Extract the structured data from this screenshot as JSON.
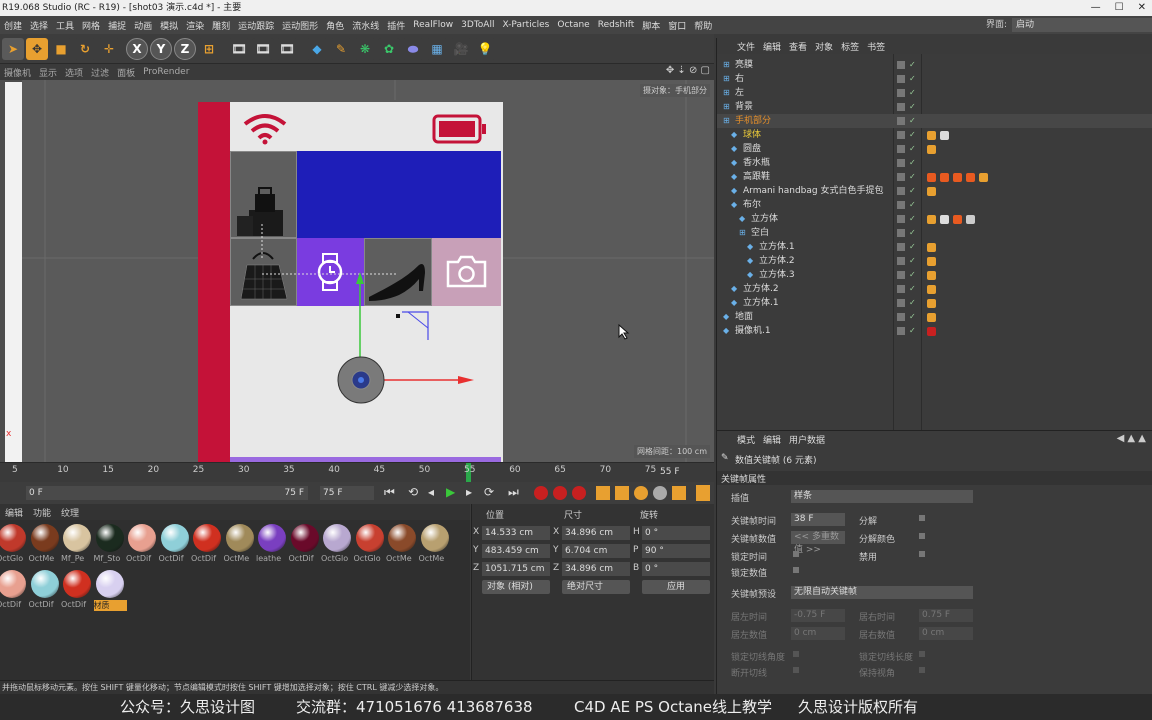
{
  "window": {
    "title": "R19.068 Studio (RC - R19) - [shot03 演示.c4d *] - 主要"
  },
  "menubar": {
    "items": [
      "创建",
      "选择",
      "工具",
      "网格",
      "捕捉",
      "动画",
      "模拟",
      "渲染",
      "雕刻",
      "运动跟踪",
      "运动图形",
      "角色",
      "流水线",
      "插件",
      "RealFlow",
      "3DToAll",
      "X-Particles",
      "Octane",
      "Redshift",
      "脚本",
      "窗口",
      "帮助"
    ],
    "layout_label": "界面:",
    "layout_value": "启动"
  },
  "viewport": {
    "menu": [
      "摄像机",
      "显示",
      "选项",
      "过滤",
      "面板",
      "ProRender"
    ],
    "camera_label": "摄对象：手机部分",
    "grid_label": "网格间距：100 cm"
  },
  "timeline": {
    "ticks": [
      "5",
      "10",
      "15",
      "20",
      "25",
      "30",
      "35",
      "40",
      "45",
      "50",
      "55",
      "60",
      "65",
      "70",
      "75"
    ],
    "current_frame": "55 F"
  },
  "playbar": {
    "start": "0 F",
    "range_end": "75 F",
    "end": "75 F"
  },
  "materials": {
    "menu": [
      "编辑",
      "功能",
      "纹理"
    ],
    "items": [
      {
        "label": "OctGlo",
        "color": "#c0392b"
      },
      {
        "label": "OctMe",
        "color": "#7a3b1e"
      },
      {
        "label": "Mf_Pe",
        "color": "#d8c4a0"
      },
      {
        "label": "Mf_Sto",
        "color": "#1b2b1f"
      },
      {
        "label": "OctDif",
        "color": "#e8a090"
      },
      {
        "label": "OctDif",
        "color": "#8fcfd8"
      },
      {
        "label": "OctDif",
        "color": "#d03020"
      },
      {
        "label": "OctMe",
        "color": "#a08a5a"
      },
      {
        "label": "leathe",
        "color": "#7a3fc0"
      },
      {
        "label": "OctDif",
        "color": "#6a0a2a"
      },
      {
        "label": "OctGlo",
        "color": "#b8a8d0"
      },
      {
        "label": "OctGlo",
        "color": "#c84030"
      },
      {
        "label": "OctMe",
        "color": "#8a4a2a"
      },
      {
        "label": "OctMe",
        "color": "#b8a070"
      },
      {
        "label": "OctDif",
        "color": "#e8a090"
      },
      {
        "label": "OctDif",
        "color": "#8fcfd8"
      },
      {
        "label": "OctDif",
        "color": "#d03020"
      },
      {
        "label": "材质",
        "color": "#d8d0f0"
      }
    ]
  },
  "coords": {
    "headers": {
      "position": "位置",
      "size": "尺寸",
      "rotation": "旋转"
    },
    "rows": [
      {
        "axis": "X",
        "pos": "14.533 cm",
        "size_axis": "X",
        "size": "34.896 cm",
        "rot_axis": "H",
        "rot": "0 °"
      },
      {
        "axis": "Y",
        "pos": "483.459 cm",
        "size_axis": "Y",
        "size": "6.704 cm",
        "rot_axis": "P",
        "rot": "90 °"
      },
      {
        "axis": "Z",
        "pos": "1051.715 cm",
        "size_axis": "Z",
        "size": "34.896 cm",
        "rot_axis": "B",
        "rot": "0 °"
      }
    ],
    "mode": "对象 (相对)",
    "size_mode": "绝对尺寸",
    "apply": "应用"
  },
  "status": "并拖动鼠标移动元素。按住 SHIFT 键量化移动；节点编辑模式时按住 SHIFT 键增加选择对象；按住 CTRL 键减少选择对象。",
  "footer": {
    "a": "公众号：久思设计图",
    "b": "交流群：471051676  413687638",
    "c": "C4D AE PS Octane线上教学",
    "d": "久思设计版权所有"
  },
  "objects": {
    "menu": [
      "文件",
      "编辑",
      "查看",
      "对象",
      "标签",
      "书签"
    ],
    "rows": [
      {
        "name": "亮膜",
        "indent": 0,
        "color": "#ddd"
      },
      {
        "name": "右",
        "indent": 0,
        "color": "#ddd"
      },
      {
        "name": "左",
        "indent": 0,
        "color": "#ddd"
      },
      {
        "name": "背景",
        "indent": 0,
        "color": "#ddd"
      },
      {
        "name": "手机部分",
        "indent": 0,
        "color": "#e8902a"
      },
      {
        "name": "球体",
        "indent": 1,
        "color": "#e8c83a"
      },
      {
        "name": "圆盘",
        "indent": 1,
        "color": "#ddd"
      },
      {
        "name": "香水瓶",
        "indent": 1,
        "color": "#ddd"
      },
      {
        "name": "高跟鞋",
        "indent": 1,
        "color": "#ddd"
      },
      {
        "name": "Armani handbag 女式白色手提包",
        "indent": 1,
        "color": "#ddd"
      },
      {
        "name": "布尔",
        "indent": 1,
        "color": "#ddd"
      },
      {
        "name": "立方体",
        "indent": 2,
        "color": "#ddd"
      },
      {
        "name": "空白",
        "indent": 2,
        "color": "#ddd"
      },
      {
        "name": "立方体.1",
        "indent": 3,
        "color": "#ddd"
      },
      {
        "name": "立方体.2",
        "indent": 3,
        "color": "#ddd"
      },
      {
        "name": "立方体.3",
        "indent": 3,
        "color": "#ddd"
      },
      {
        "name": "立方体.2",
        "indent": 1,
        "color": "#ddd"
      },
      {
        "name": "立方体.1",
        "indent": 1,
        "color": "#ddd"
      },
      {
        "name": "地面",
        "indent": 0,
        "color": "#ddd"
      },
      {
        "name": "摄像机.1",
        "indent": 0,
        "color": "#ddd"
      }
    ]
  },
  "attributes": {
    "menu": [
      "模式",
      "编辑",
      "用户数据"
    ],
    "header": "数值关键帧 (6 元素)",
    "section1": "关键帧属性",
    "interp_label": "插值",
    "interp_value": "样条",
    "key_time_label": "关键帧时间",
    "key_time_value": "38 F",
    "key_value_label": "关键帧数值",
    "key_value_value": "<< 多重数值 >>",
    "lock_time": "锁定时间",
    "lock_value": "锁定数值",
    "break_label": "分解",
    "break_color": "分解颜色",
    "mute": "禁用",
    "preset_label": "关键帧预设",
    "preset_value": "无限自动关键帧",
    "left_time": "居左时间",
    "left_time_val": "-0.75 F",
    "right_time": "居右时间",
    "right_time_val": "0.75 F",
    "left_value": "居左数值",
    "left_value_val": "0 cm",
    "right_value": "居右数值",
    "right_value_val": "0 cm",
    "lock_tangent_angle": "锁定切线角度",
    "lock_tangent_len": "锁定切线长度",
    "break_tangent": "断开切线",
    "keep_visual": "保持视角"
  }
}
